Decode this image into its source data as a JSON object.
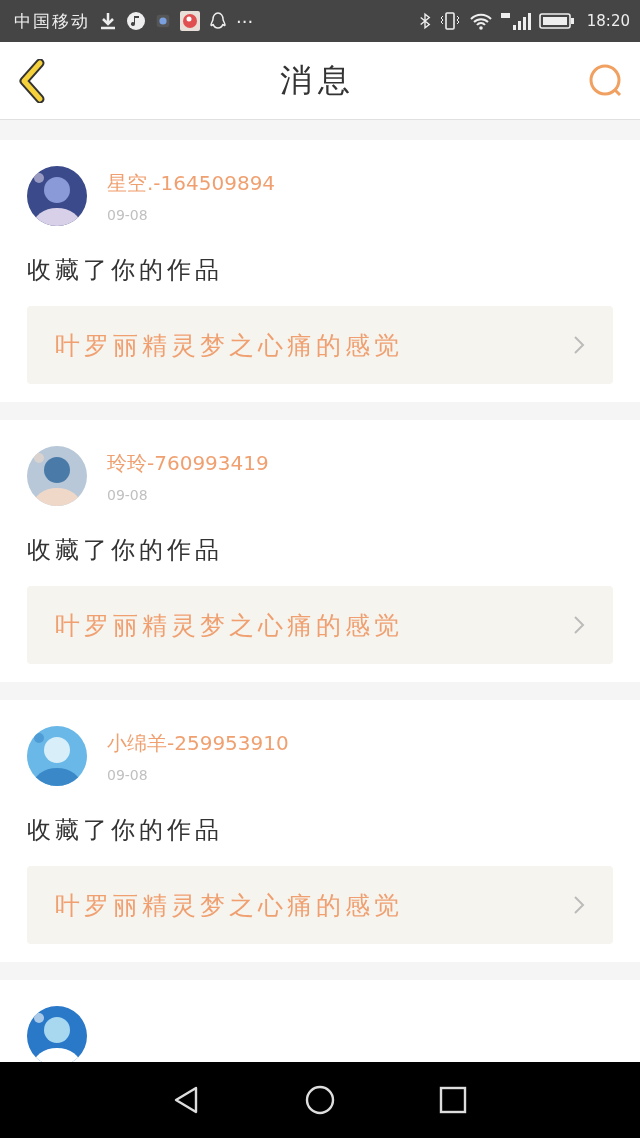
{
  "status_bar": {
    "carrier": "中国移动",
    "more": "···",
    "time": "18:20"
  },
  "header": {
    "title": "消息"
  },
  "messages": [
    {
      "avatar": {
        "kind": "picture"
      },
      "name": "星空.-164509894",
      "date": "09-08",
      "action": "收藏了你的作品",
      "work": "叶罗丽精灵梦之心痛的感觉"
    },
    {
      "avatar": {
        "kind": "picture"
      },
      "name": "玲玲-760993419",
      "date": "09-08",
      "action": "收藏了你的作品",
      "work": "叶罗丽精灵梦之心痛的感觉"
    },
    {
      "avatar": {
        "kind": "picture"
      },
      "name": "小绵羊-259953910",
      "date": "09-08",
      "action": "收藏了你的作品",
      "work": "叶罗丽精灵梦之心痛的感觉"
    },
    {
      "avatar": {
        "kind": "picture"
      }
    }
  ]
}
